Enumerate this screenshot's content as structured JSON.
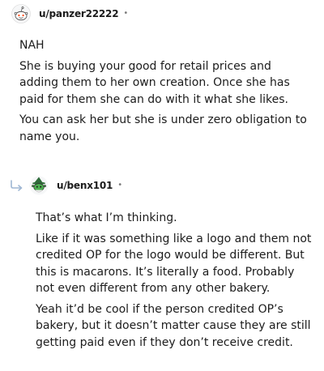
{
  "comments": [
    {
      "username": "u/panzer22222",
      "separator": "•",
      "avatar_icon": "snoo-avatar-icon",
      "paragraphs": [
        "NAH",
        "She is buying your good for retail prices and adding them to her own creation. Once she has paid for them she can do with it what she likes.",
        "You can ask her but she is under zero obligation to name you."
      ]
    },
    {
      "username": "u/benx101",
      "separator": "•",
      "avatar_icon": "snoo-wizard-avatar-icon",
      "reply_icon": "reply-arrow-icon",
      "paragraphs": [
        "That’s what I’m thinking.",
        "Like if it was something like a logo and them not credited OP for the logo would be different. But this is macarons. It’s literally a food. Probably not even different from any other bakery.",
        "Yeah it’d be cool if the person credited OP’s bakery, but it doesn’t matter cause they are still getting paid even if they don’t receive credit."
      ]
    }
  ],
  "colors": {
    "text": "#1c1c1c",
    "muted": "#7c7c7c",
    "reply_arrow": "#9fb7d4",
    "wizard_green": "#3c9a3c"
  }
}
